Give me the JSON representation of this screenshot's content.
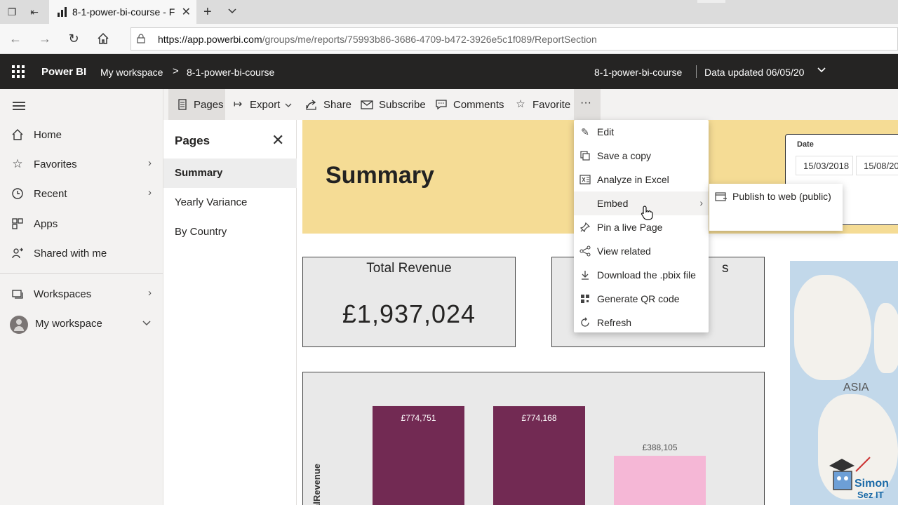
{
  "browser": {
    "tab_title": "8-1-power-bi-course - F",
    "url_domain": "https://app.powerbi.com",
    "url_path": "/groups/me/reports/75993b86-3686-4709-b472-3926e5c1f089/ReportSection"
  },
  "header": {
    "brand": "Power BI",
    "breadcrumb_workspace": "My workspace",
    "breadcrumb_sep": ">",
    "breadcrumb_report": "8-1-power-bi-course",
    "report_title": "8-1-power-bi-course",
    "data_updated": "Data updated 06/05/20"
  },
  "leftnav": {
    "items": [
      {
        "label": "Home",
        "icon": "home-icon"
      },
      {
        "label": "Favorites",
        "icon": "star-icon"
      },
      {
        "label": "Recent",
        "icon": "clock-icon"
      },
      {
        "label": "Apps",
        "icon": "apps-icon"
      },
      {
        "label": "Shared with me",
        "icon": "shared-icon"
      },
      {
        "label": "Workspaces",
        "icon": "workspaces-icon"
      },
      {
        "label": "My workspace",
        "icon": "avatar"
      }
    ]
  },
  "toolbar": {
    "pages": "Pages",
    "export": "Export",
    "share": "Share",
    "subscribe": "Subscribe",
    "comments": "Comments",
    "favorite": "Favorite",
    "more": "···"
  },
  "pages_pane": {
    "title": "Pages",
    "items": [
      "Summary",
      "Yearly Variance",
      "By Country"
    ]
  },
  "report": {
    "title": "Summary",
    "slicer_label": "Date",
    "date_from": "15/03/2018",
    "date_to": "15/08/20",
    "card1_title": "Total Revenue",
    "card1_value": "£1,937,024",
    "card2_title": "s",
    "map_label": "ASIA",
    "chart_axis_label": "alRevenue"
  },
  "chart_data": {
    "type": "bar",
    "categories": [
      "",
      "",
      ""
    ],
    "values": [
      774751,
      774168,
      388105
    ],
    "value_labels": [
      "£774,751",
      "£774,168",
      "£388,105"
    ],
    "colors": [
      "#722a53",
      "#722a53",
      "#f5b7d6"
    ],
    "ylabel": "alRevenue",
    "ylim": [
      0,
      900000
    ]
  },
  "menu": {
    "items": [
      {
        "label": "Edit",
        "icon": "pencil-icon"
      },
      {
        "label": "Save a copy",
        "icon": "copy-icon"
      },
      {
        "label": "Analyze in Excel",
        "icon": "excel-icon"
      },
      {
        "label": "Embed",
        "icon": "none"
      },
      {
        "label": "Pin a live Page",
        "icon": "pin-icon"
      },
      {
        "label": "View related",
        "icon": "related-icon"
      },
      {
        "label": "Download the .pbix file",
        "icon": "download-icon"
      },
      {
        "label": "Generate QR code",
        "icon": "qr-icon"
      },
      {
        "label": "Refresh",
        "icon": "refresh-icon"
      }
    ],
    "submenu_item": "Publish to web (public)"
  },
  "colors": {
    "header_bg": "#252423",
    "banner_bg": "#f5dc95",
    "bar_dark": "#722a53",
    "bar_light": "#f5b7d6"
  }
}
